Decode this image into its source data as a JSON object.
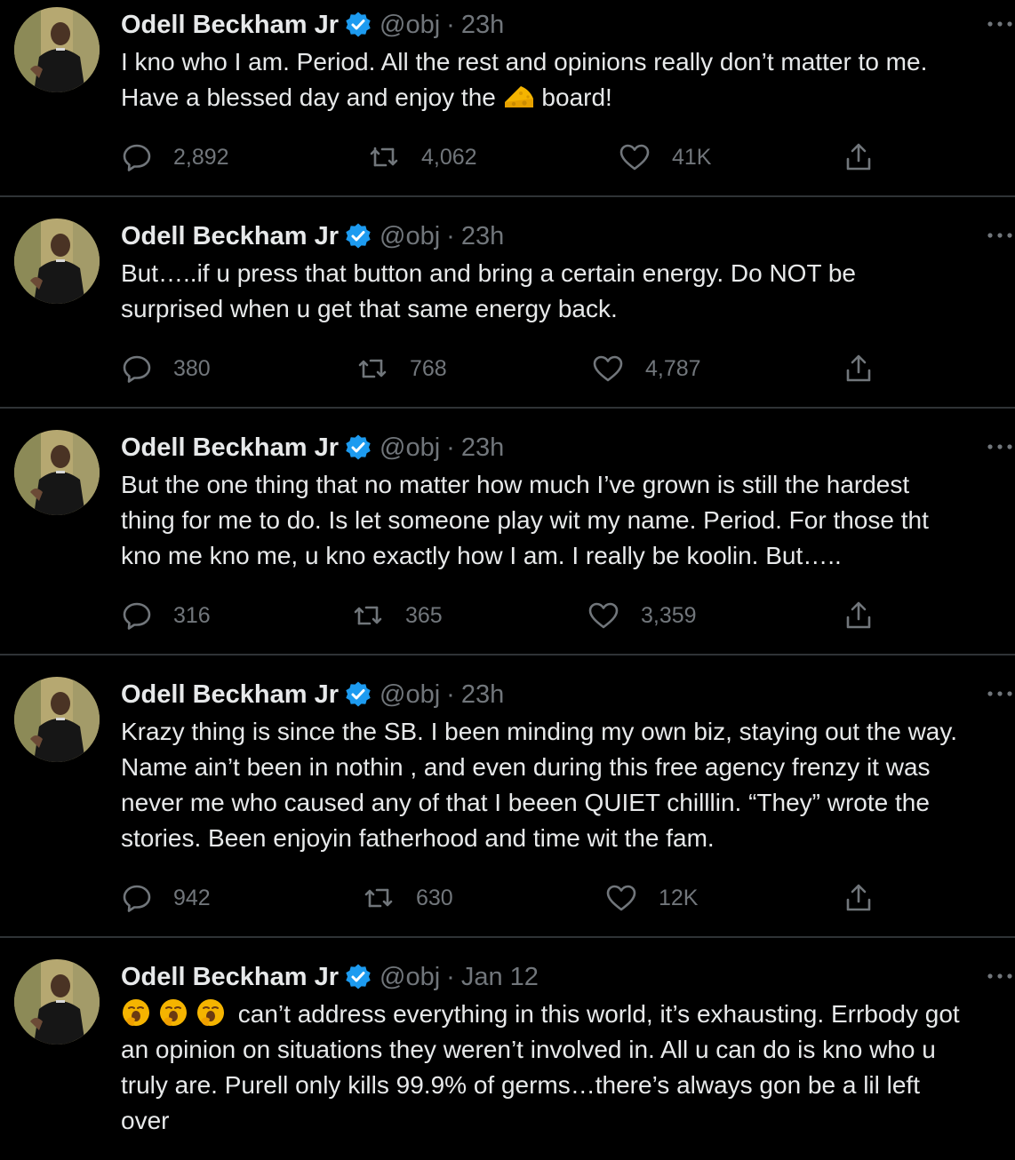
{
  "tweets": [
    {
      "name": "Odell Beckham Jr",
      "handle": "@obj",
      "separator": "·",
      "time": "23h",
      "lines": [
        "I kno who I am. Period. All the rest and opinions really don’t matter to me.",
        "Have a blessed day and enjoy the",
        "board!"
      ],
      "inline_emoji": "cheese-icon",
      "replies": "2,892",
      "retweets": "4,062",
      "likes": "41K"
    },
    {
      "name": "Odell Beckham Jr",
      "handle": "@obj",
      "separator": "·",
      "time": "23h",
      "lines": [
        "But…..if u press that button and bring a certain energy. Do NOT be",
        "surprised when u get that same energy back."
      ],
      "replies": "380",
      "retweets": "768",
      "likes": "4,787"
    },
    {
      "name": "Odell Beckham Jr",
      "handle": "@obj",
      "separator": "·",
      "time": "23h",
      "lines": [
        "But the one thing that no matter how much I’ve grown is still the hardest",
        "thing for me to do. Is let someone play wit my name. Period. For those tht",
        "kno me kno me, u kno exactly how I am. I really be koolin. But….."
      ],
      "replies": "316",
      "retweets": "365",
      "likes": "3,359"
    },
    {
      "name": "Odell Beckham Jr",
      "handle": "@obj",
      "separator": "·",
      "time": "23h",
      "lines": [
        "Krazy thing is since the SB. I been minding my own biz, staying out the way.",
        "Name ain’t been in nothin , and even during this free agency frenzy it was",
        "never me who caused any of that I beeen QUIET chilllin. “They” wrote the",
        "stories. Been enjoyin fatherhood and time wit the fam."
      ],
      "replies": "942",
      "retweets": "630",
      "likes": "12K"
    },
    {
      "name": "Odell Beckham Jr",
      "handle": "@obj",
      "separator": "·",
      "time": "Jan 12",
      "lines": [
        "can’t address everything in this world, it’s exhausting. Errbody got",
        "an opinion on situations they weren’t involved in. All u can do is kno who u",
        "truly are. Purell only kills 99.9% of germs…there’s always gon be a lil left",
        "over"
      ],
      "leading_emoji": "yawning-face-icon"
    }
  ],
  "colors": {
    "background": "#000000",
    "text": "#e7e9ea",
    "muted": "#71767b",
    "divider": "#2f3336",
    "verified": "#1d9bf0"
  }
}
